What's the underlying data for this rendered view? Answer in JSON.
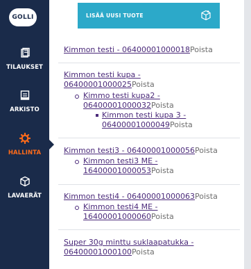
{
  "brand": {
    "logo_text": "GOLLI"
  },
  "nav": {
    "items": [
      {
        "label": "TILAUKSET",
        "icon": "orders-icon"
      },
      {
        "label": "ARKISTO",
        "icon": "archive-icon"
      },
      {
        "label": "HALLINTA",
        "icon": "gear-icon",
        "active": true
      },
      {
        "label": "LAVAERÄT",
        "icon": "cube-icon"
      }
    ]
  },
  "banner": {
    "label": "LISÄÄ UUSI TUOTE",
    "icon": "add-box-icon"
  },
  "colors": {
    "sidebar_bg": "#1a2b4a",
    "accent": "#ff6b1a",
    "banner_bg": "#2ca9c9",
    "link": "#4b2a7a"
  },
  "products": {
    "p1": {
      "name": "Kimmon testi - 06400001000018",
      "action": "Poista"
    },
    "p2": {
      "name": "Kimmon testi kupa - 06400001000025",
      "action": "Poista"
    },
    "p2a": {
      "name": "Kimmo testi kupa2 - 06400001000032",
      "action": "Poista"
    },
    "p2b": {
      "name": "Kimmon testi kupa 3 - 06400001000049",
      "action": "Poista"
    },
    "p3": {
      "name": "Kimmon testi3 - 06400001000056",
      "action": "Poista"
    },
    "p3a": {
      "name": "Kimmon testi3 ME - 16400001000053",
      "action": "Poista"
    },
    "p4": {
      "name": "Kimmon testi4 - 06400001000063",
      "action": "Poista"
    },
    "p4a": {
      "name": "Kimmon testi4 ME - 16400001000060",
      "action": "Poista"
    },
    "p5": {
      "name": "Super 30g minttu suklaapatukka - 06400001000100",
      "action": "Poista"
    }
  }
}
